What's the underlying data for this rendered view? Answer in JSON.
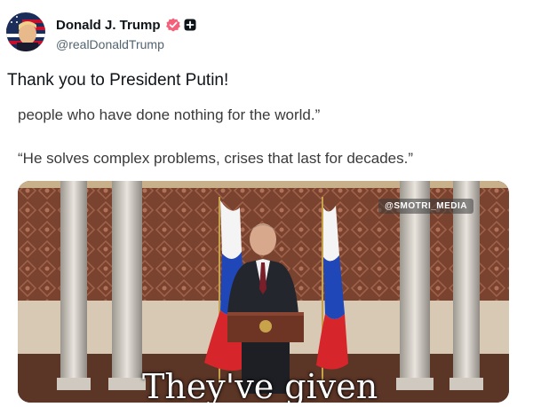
{
  "post": {
    "display_name": "Donald J. Trump",
    "handle": "@realDonaldTrump",
    "text": "Thank you to President Putin!",
    "verified_icon": "verified-badge-icon",
    "affiliation_icon": "plus-square-icon"
  },
  "embedded_screenshot": {
    "line1": "people who have done nothing for the world.”",
    "line2": "“He solves complex problems, crises that last for decades.”"
  },
  "video": {
    "watermark": "@SMOTRI_MEDIA",
    "subtitle": "They've given"
  },
  "colors": {
    "verified": "#f4607a",
    "text": "#0f1419",
    "secondary": "#536471"
  }
}
